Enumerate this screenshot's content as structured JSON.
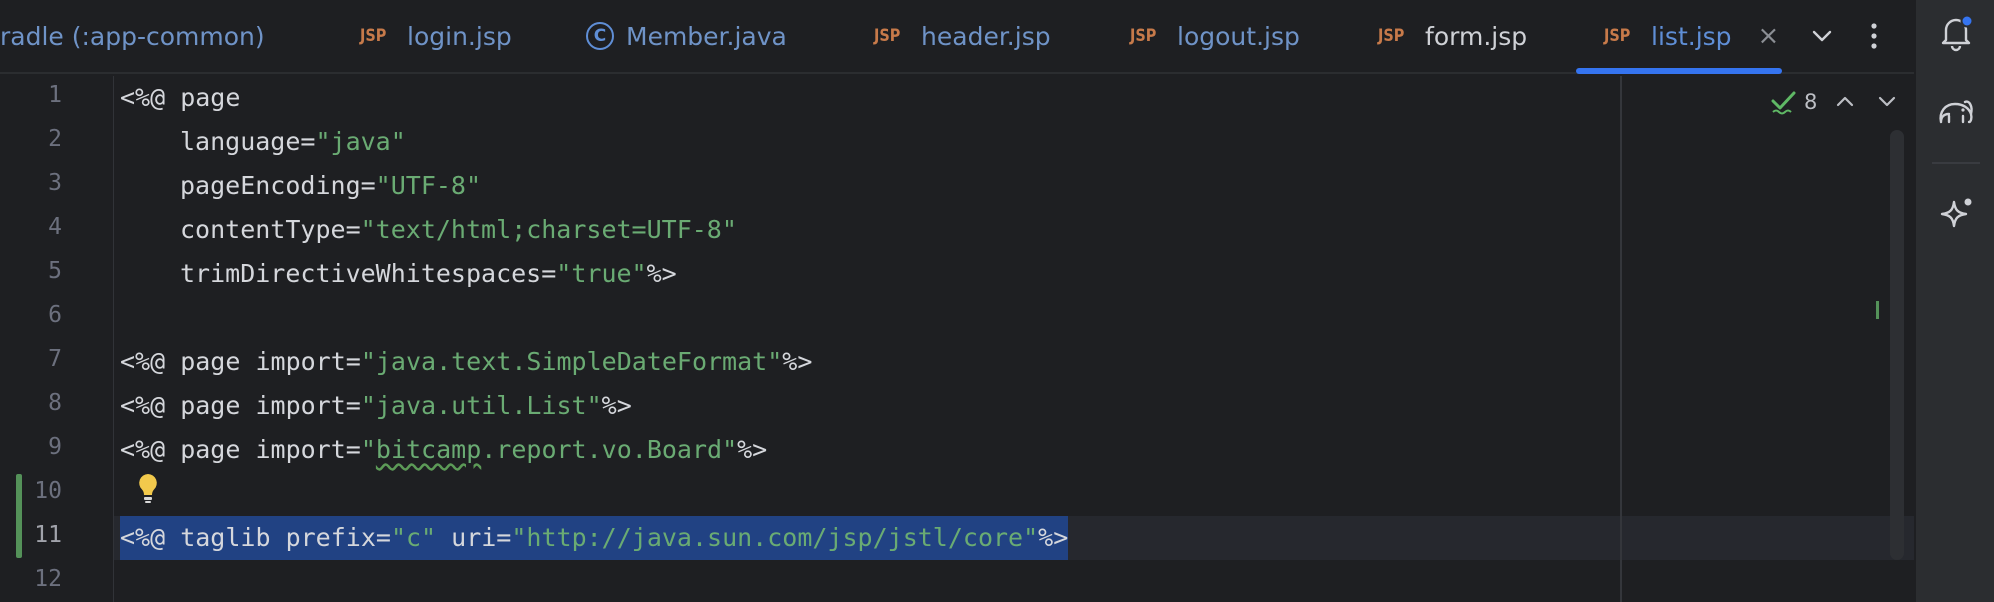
{
  "tabs": [
    {
      "label": "radle (:app-common)",
      "type": "gradle",
      "active": false
    },
    {
      "label": "login.jsp",
      "type": "jsp",
      "active": false
    },
    {
      "label": "Member.java",
      "type": "class",
      "active": false
    },
    {
      "label": "header.jsp",
      "type": "jsp",
      "active": false
    },
    {
      "label": "logout.jsp",
      "type": "jsp",
      "active": false
    },
    {
      "label": "form.jsp",
      "type": "jsp",
      "active": false
    },
    {
      "label": "list.jsp",
      "type": "jsp",
      "active": true
    }
  ],
  "file_badge": "JSP",
  "class_badge": "C",
  "close_glyph": "×",
  "inspection": {
    "count": "8"
  },
  "gutter": {
    "lines": [
      "1",
      "2",
      "3",
      "4",
      "5",
      "6",
      "7",
      "8",
      "9",
      "10",
      "11",
      "12"
    ],
    "current_line": "11"
  },
  "code": {
    "l1": {
      "a": "<%@ page"
    },
    "l2": {
      "a": "language=",
      "s": "\"java\""
    },
    "l3": {
      "a": "pageEncoding=",
      "s": "\"UTF-8\""
    },
    "l4": {
      "a": "contentType=",
      "s": "\"text/html;charset=UTF-8\""
    },
    "l5": {
      "a": "trimDirectiveWhitespaces=",
      "s": "\"true\"",
      "e": "%>"
    },
    "l7": {
      "a": "<%@ page import=",
      "s": "\"java.text.SimpleDateFormat\"",
      "e": "%>"
    },
    "l8": {
      "a": "<%@ page import=",
      "s": "\"java.util.List\"",
      "e": "%>"
    },
    "l9": {
      "a": "<%@ page import=",
      "q": "\"",
      "w": "bitcamp",
      "s": ".report.vo.Board\"",
      "e": "%>"
    },
    "l11": {
      "a": "<%@ taglib prefix=",
      "s1": "\"c\"",
      "b": " uri=",
      "s2": "\"http://java.sun.com/jsp/jstl/core\"",
      "e": "%>"
    }
  },
  "colors": {
    "accent": "#3574f0",
    "string": "#6aab73",
    "background": "#1e1f22",
    "selection": "#214283"
  },
  "icons": [
    "tab-list-chevron-icon",
    "more-options-icon",
    "notifications-icon",
    "gradle-elephant-icon",
    "ai-assistant-sparkle-icon",
    "inspection-check-icon",
    "lightbulb-icon"
  ]
}
